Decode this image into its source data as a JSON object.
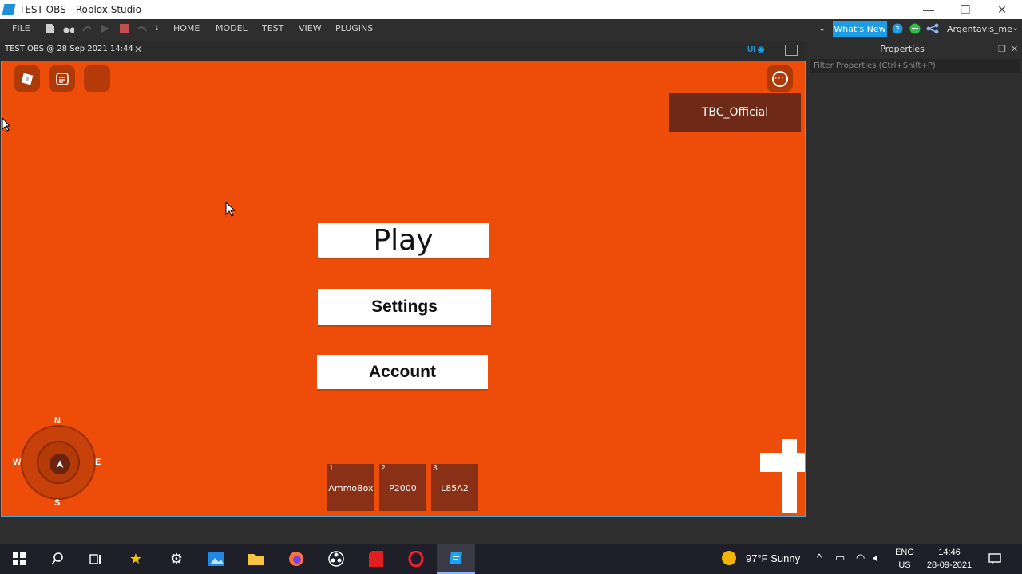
{
  "window": {
    "title": "TEST OBS - Roblox Studio",
    "minimize": "—",
    "restore": "❐",
    "close": "✕"
  },
  "menubar": {
    "file": "FILE",
    "tabs": [
      "HOME",
      "MODEL",
      "TEST",
      "VIEW",
      "PLUGINS"
    ],
    "whats_new": "What's New",
    "user": "Argentavis_me"
  },
  "doc_tab": {
    "label": "TEST OBS @ 28 Sep 2021 14:44",
    "close": "✕",
    "ui_toggle": "UI"
  },
  "game": {
    "username": "TBC_Official",
    "buttons": {
      "play": "Play",
      "settings": "Settings",
      "account": "Account"
    },
    "compass": {
      "n": "N",
      "s": "S",
      "e": "E",
      "w": "W",
      "arrow": "➤"
    },
    "hotbar": [
      {
        "num": "1",
        "label": "AmmoBox"
      },
      {
        "num": "2",
        "label": "P2000"
      },
      {
        "num": "3",
        "label": "L85A2"
      }
    ],
    "colors": {
      "background": "#ee4d09",
      "panel": "#6e2a16"
    }
  },
  "properties": {
    "title": "Properties",
    "filter_placeholder": "Filter Properties (Ctrl+Shift+P)"
  },
  "taskbar": {
    "weather": "97°F  Sunny",
    "lang_top": "ENG",
    "lang_bottom": "US",
    "time": "14:46",
    "date": "28-09-2021"
  }
}
